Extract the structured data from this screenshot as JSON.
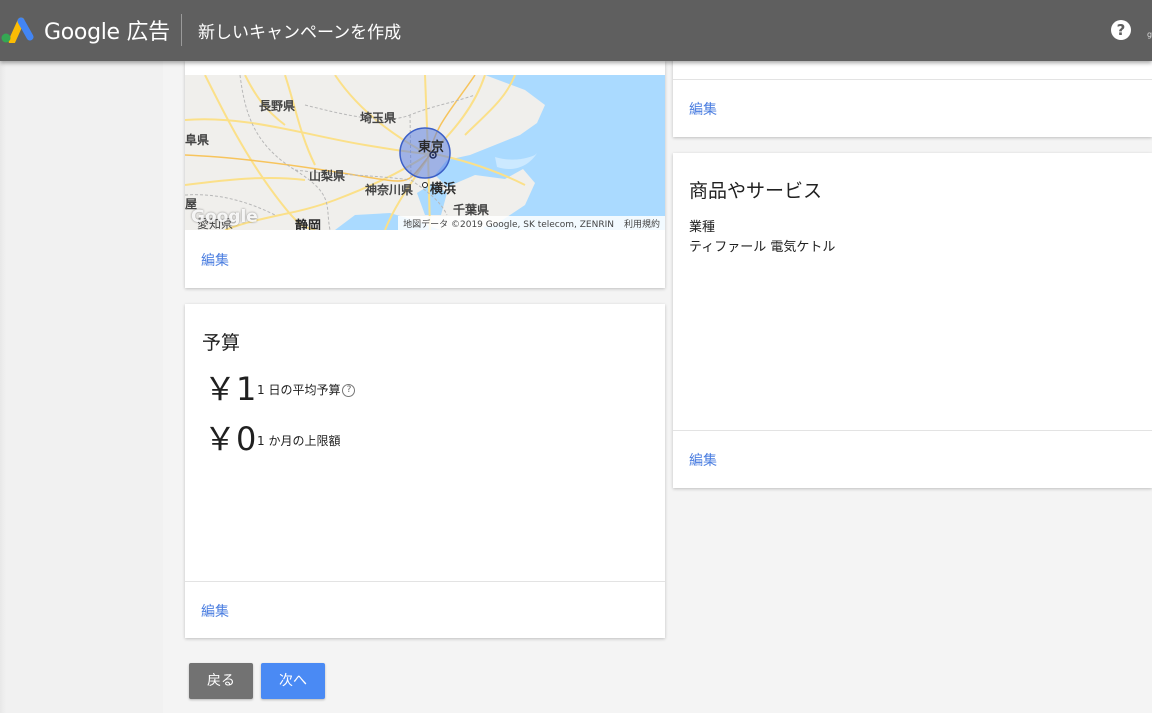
{
  "header": {
    "brand": "Google 広告",
    "title": "新しいキャンペーンを作成",
    "help_glyph": "?"
  },
  "colors": {
    "topbar": "#5f5f5f",
    "link": "#4a7de0",
    "primary_button": "#4a8af4",
    "secondary_button": "#727272",
    "radius_circle": "#5c7fe0"
  },
  "location_card": {
    "map_labels": {
      "nagano": "長野県",
      "saitama": "埼玉県",
      "gunma_partial": "阜県",
      "tokyo": "東京",
      "yamanashi": "山梨県",
      "kanagawa": "神奈川県",
      "yokohama": "横浜",
      "chiba": "千葉県",
      "nagoya_partial": "屋",
      "aichi": "愛知県",
      "shizuoka": "静岡"
    },
    "map_watermark": "Google",
    "map_attribution": "地図データ ©2019 Google, SK telecom, ZENRIN",
    "map_terms": "利用規約",
    "edit_label": "編集"
  },
  "budget_card": {
    "title": "予算",
    "daily_amount": "￥1",
    "daily_caption": "1 日の平均予算",
    "info_icon": "?",
    "monthly_amount": "￥0",
    "monthly_caption": "1 か月の上限額",
    "edit_label": "編集"
  },
  "right_top_card": {
    "edit_label": "編集"
  },
  "products_card": {
    "title": "商品やサービス",
    "field_label": "業種",
    "field_value": "ティファール 電気ケトル",
    "edit_label": "編集"
  },
  "footer": {
    "back_label": "戻る",
    "next_label": "次へ"
  }
}
